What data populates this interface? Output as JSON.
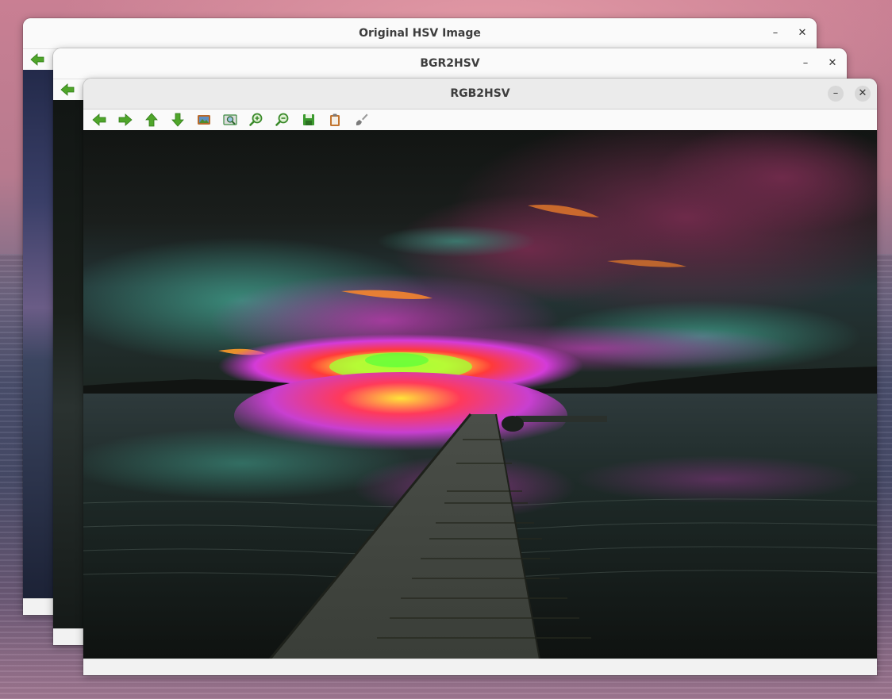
{
  "windows": {
    "back": {
      "title": "Original HSV Image",
      "minimize_glyph": "–",
      "close_glyph": "✕"
    },
    "middle": {
      "title": "BGR2HSV",
      "minimize_glyph": "–",
      "close_glyph": "✕"
    },
    "front": {
      "title": "RGB2HSV",
      "minimize_glyph": "–",
      "close_glyph": "✕"
    }
  },
  "toolbar": {
    "buttons": [
      {
        "name": "pan-left-icon",
        "color": "#4fa52a"
      },
      {
        "name": "pan-right-icon",
        "color": "#4fa52a"
      },
      {
        "name": "pan-up-icon",
        "color": "#4fa52a"
      },
      {
        "name": "pan-down-icon",
        "color": "#4fa52a"
      },
      {
        "name": "zoom-to-fit-icon",
        "color": "#b86a2c"
      },
      {
        "name": "zoom-to-region-icon",
        "color": "#3b8a3f"
      },
      {
        "name": "zoom-in-icon",
        "color": "#3a8a2a"
      },
      {
        "name": "zoom-out-icon",
        "color": "#3a8a2a"
      },
      {
        "name": "save-icon",
        "color": "#3b9a2e"
      },
      {
        "name": "copy-to-clipboard-icon",
        "color": "#c2742e"
      },
      {
        "name": "properties-brush-icon",
        "color": "#777777"
      }
    ]
  }
}
